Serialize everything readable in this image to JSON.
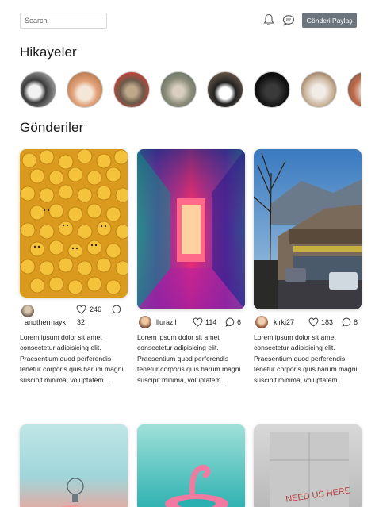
{
  "header": {
    "search_placeholder": "Search",
    "icons": [
      "bell-icon",
      "chat-icon"
    ],
    "share_button": "Gönderi Paylaş"
  },
  "stories": {
    "title": "Hikayeler",
    "count_visible": 8
  },
  "posts": {
    "title": "Gönderiler",
    "items": [
      {
        "username": "anothermayk",
        "likes": "246",
        "comments": "32",
        "description": "Lorem ipsum dolor sit amet consectetur adipisicing elit. Praesentium quod perferendis tenetur corporis quis harum magni suscipit minima, voluptatem..."
      },
      {
        "username": "llurazll",
        "likes": "114",
        "comments": "6",
        "description": "Lorem ipsum dolor sit amet consectetur adipisicing elit. Praesentium quod perferendis tenetur corporis quis harum magni suscipit minima, voluptatem..."
      },
      {
        "username": "kirkj27",
        "likes": "183",
        "comments": "8",
        "description": "Lorem ipsum dolor sit amet consectetur adipisicing elit. Praesentium quod perferendis tenetur corporis quis harum magni suscipit minima, voluptatem..."
      }
    ],
    "bottom_row_sign_text": "NEED US HERE"
  },
  "colors": {
    "button_bg": "#6c757d",
    "text": "#212529"
  }
}
